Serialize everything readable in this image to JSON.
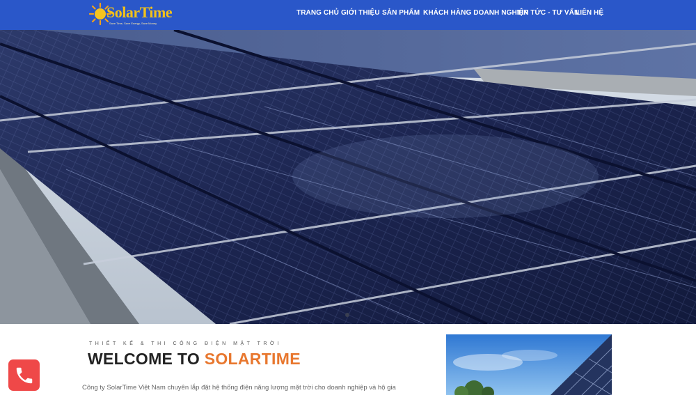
{
  "header": {
    "logo": {
      "brand": "SolarTime",
      "tagline": "Save Time, Save Energy, Save Money",
      "icon": "sun-icon"
    },
    "nav": [
      {
        "label": "TRANG CHỦ"
      },
      {
        "label": "GIỚI THIỆU"
      },
      {
        "label": "SẢN PHẨM"
      },
      {
        "label": "KHÁCH HÀNG DOANH NGHIỆP"
      },
      {
        "label": "TIN TỨC - TƯ VẤN"
      },
      {
        "label": "LIÊN HỆ"
      }
    ]
  },
  "hero": {
    "image": "solar-panel-rooftop-photo",
    "active_slide_indicator": true
  },
  "intro": {
    "eyebrow": "THIẾT KẾ & THI CÔNG ĐIỆN MẶT TRỜI",
    "title_prefix": "WELCOME TO ",
    "title_accent": "SOLARTIME",
    "body": "Công ty SolarTime Việt Nam chuyên lắp đặt hệ thống điện năng lượng mặt trời cho doanh nghiệp và hộ gia"
  },
  "side_image": "solar-panels-sky-photo",
  "call_button": {
    "icon": "phone-icon"
  },
  "colors": {
    "header_bg": "#2a57c9",
    "accent": "#e8772e",
    "call_button": "#ef4848",
    "logo_yellow": "#f3c21a"
  }
}
